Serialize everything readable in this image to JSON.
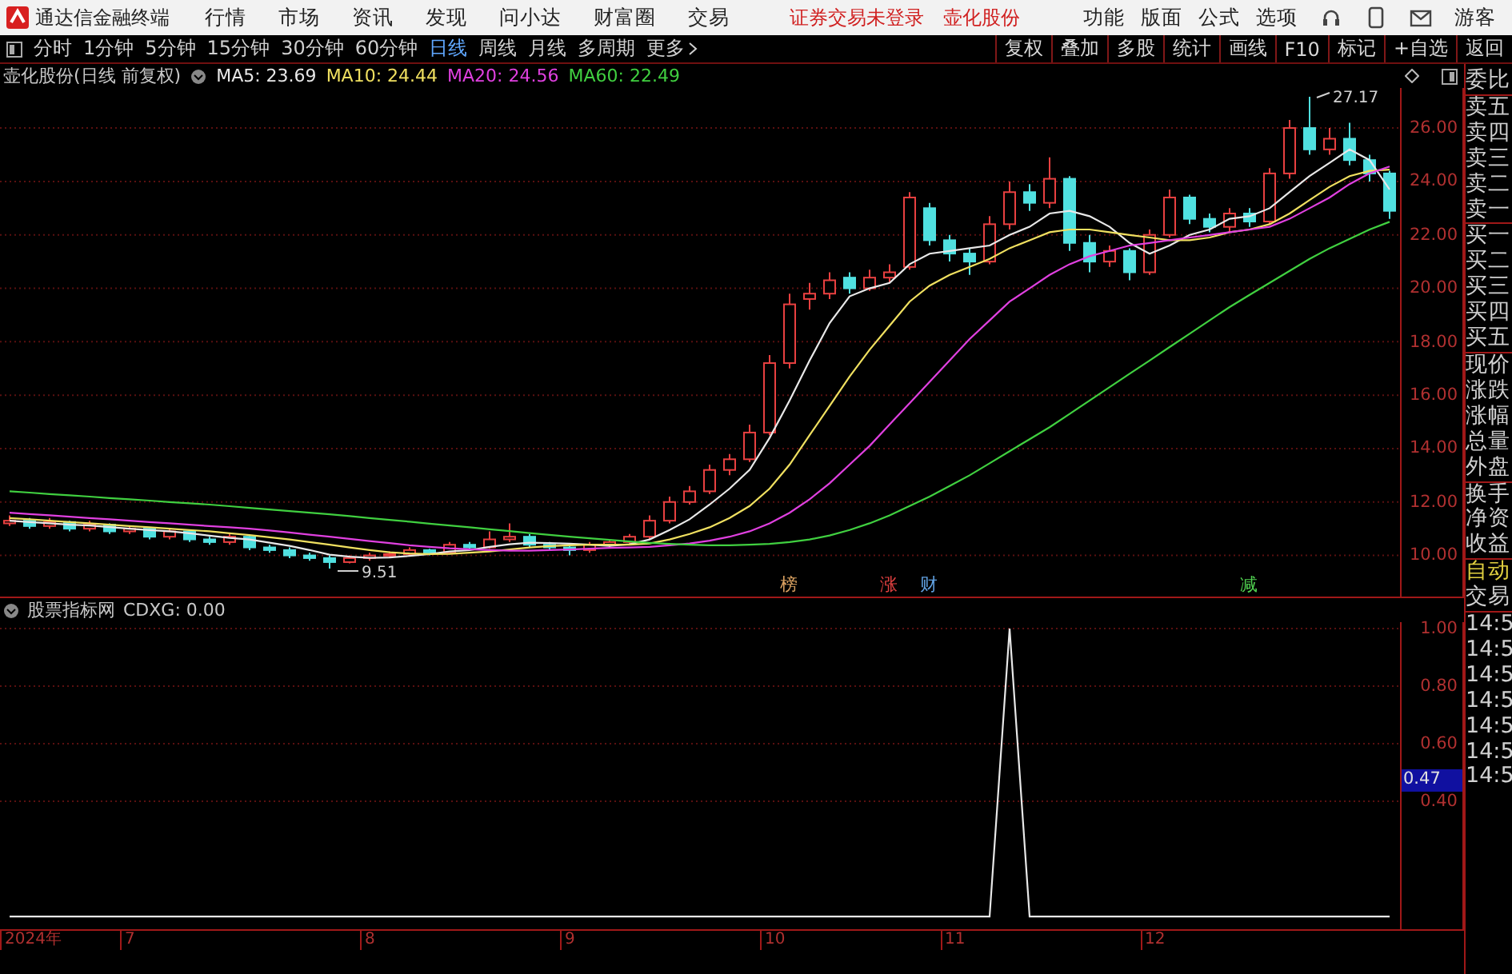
{
  "menu_bar": {
    "app_title": "通达信金融终端",
    "items": [
      "行情",
      "市场",
      "资讯",
      "发现",
      "问小达",
      "财富圈",
      "交易"
    ],
    "notices": [
      "证券交易未登录",
      "壶化股份"
    ],
    "right_items": [
      "功能",
      "版面",
      "公式",
      "选项"
    ],
    "user": "游客"
  },
  "toolbar": {
    "periods": [
      {
        "label": "分时",
        "selected": false
      },
      {
        "label": "1分钟",
        "selected": false
      },
      {
        "label": "5分钟",
        "selected": false
      },
      {
        "label": "15分钟",
        "selected": false
      },
      {
        "label": "30分钟",
        "selected": false
      },
      {
        "label": "60分钟",
        "selected": false
      },
      {
        "label": "日线",
        "selected": true
      },
      {
        "label": "周线",
        "selected": false
      },
      {
        "label": "月线",
        "selected": false
      },
      {
        "label": "多周期",
        "selected": false
      },
      {
        "label": "更多",
        "selected": false
      }
    ],
    "actions": [
      "复权",
      "叠加",
      "多股",
      "统计",
      "画线",
      "F10",
      "标记",
      "+自选",
      "返回"
    ]
  },
  "price_chart": {
    "title": "壶化股份(日线 前复权)",
    "ma": [
      {
        "label": "MA5: 23.69",
        "color": "#e8e8e8"
      },
      {
        "label": "MA10: 24.44",
        "color": "#f0e060"
      },
      {
        "label": "MA20: 24.56",
        "color": "#e040e0"
      },
      {
        "label": "MA60: 22.49",
        "color": "#40d040"
      }
    ],
    "high_label": "27.17",
    "low_label": "9.51",
    "markers": [
      {
        "text": "榜",
        "color": "#d8a060"
      },
      {
        "text": "涨",
        "color": "#e04040"
      },
      {
        "text": "财",
        "color": "#60a0e0"
      },
      {
        "text": "减",
        "color": "#50d050"
      }
    ],
    "chart_data": {
      "type": "candlestick",
      "ylim": [
        8.46,
        27.5
      ],
      "grid": true,
      "yticks": [
        {
          "value": 26,
          "label": "26.00"
        },
        {
          "value": 24,
          "label": "24.00"
        },
        {
          "value": 22,
          "label": "22.00"
        },
        {
          "value": 20,
          "label": "20.00"
        },
        {
          "value": 18,
          "label": "18.00"
        },
        {
          "value": 16,
          "label": "16.00"
        },
        {
          "value": 14,
          "label": "14.00"
        },
        {
          "value": 12,
          "label": "12.00"
        },
        {
          "value": 10,
          "label": "10.00"
        }
      ],
      "ohlc": [
        [
          11.2,
          11.5,
          11.1,
          11.3
        ],
        [
          11.3,
          11.4,
          11.0,
          11.1
        ],
        [
          11.1,
          11.4,
          11.0,
          11.25
        ],
        [
          11.25,
          11.3,
          10.9,
          11.0
        ],
        [
          11.0,
          11.3,
          10.9,
          11.15
        ],
        [
          11.15,
          11.2,
          10.8,
          10.9
        ],
        [
          10.9,
          11.1,
          10.8,
          11.0
        ],
        [
          11.0,
          11.05,
          10.6,
          10.7
        ],
        [
          10.7,
          11.0,
          10.6,
          10.9
        ],
        [
          10.9,
          10.95,
          10.5,
          10.6
        ],
        [
          10.6,
          10.7,
          10.4,
          10.5
        ],
        [
          10.5,
          10.8,
          10.4,
          10.7
        ],
        [
          10.7,
          10.75,
          10.2,
          10.3
        ],
        [
          10.3,
          10.4,
          10.1,
          10.2
        ],
        [
          10.2,
          10.3,
          9.9,
          10.0
        ],
        [
          10.0,
          10.1,
          9.8,
          9.9
        ],
        [
          9.9,
          10.0,
          9.51,
          9.75
        ],
        [
          9.75,
          10.0,
          9.7,
          9.9
        ],
        [
          9.9,
          10.1,
          9.8,
          10.0
        ],
        [
          10.0,
          10.15,
          9.9,
          10.05
        ],
        [
          10.05,
          10.3,
          10.0,
          10.2
        ],
        [
          10.2,
          10.25,
          10.0,
          10.1
        ],
        [
          10.1,
          10.5,
          10.05,
          10.4
        ],
        [
          10.4,
          10.5,
          10.2,
          10.3
        ],
        [
          10.3,
          10.9,
          10.25,
          10.6
        ],
        [
          10.6,
          11.2,
          10.5,
          10.7
        ],
        [
          10.7,
          10.8,
          10.3,
          10.4
        ],
        [
          10.4,
          10.5,
          10.2,
          10.3
        ],
        [
          10.3,
          10.4,
          10.0,
          10.2
        ],
        [
          10.2,
          10.5,
          10.1,
          10.4
        ],
        [
          10.4,
          10.6,
          10.3,
          10.5
        ],
        [
          10.5,
          10.8,
          10.4,
          10.7
        ],
        [
          10.7,
          11.5,
          10.6,
          11.3
        ],
        [
          11.3,
          12.2,
          11.2,
          12.0
        ],
        [
          12.0,
          12.6,
          11.9,
          12.4
        ],
        [
          12.4,
          13.4,
          12.3,
          13.2
        ],
        [
          13.2,
          13.8,
          13.0,
          13.6
        ],
        [
          13.6,
          14.9,
          13.5,
          14.6
        ],
        [
          14.6,
          17.5,
          14.5,
          17.2
        ],
        [
          17.2,
          19.8,
          17.0,
          19.4
        ],
        [
          19.6,
          20.2,
          19.2,
          19.8
        ],
        [
          19.8,
          20.6,
          19.6,
          20.3
        ],
        [
          20.4,
          20.6,
          19.8,
          20.0
        ],
        [
          20.0,
          20.7,
          19.9,
          20.4
        ],
        [
          20.4,
          20.9,
          20.2,
          20.6
        ],
        [
          20.8,
          23.6,
          20.7,
          23.4
        ],
        [
          23.0,
          23.2,
          21.6,
          21.8
        ],
        [
          21.8,
          22.0,
          21.0,
          21.3
        ],
        [
          21.3,
          21.5,
          20.5,
          21.0
        ],
        [
          21.0,
          22.7,
          20.9,
          22.4
        ],
        [
          22.4,
          24.0,
          22.2,
          23.6
        ],
        [
          23.6,
          23.9,
          22.9,
          23.2
        ],
        [
          23.2,
          24.9,
          23.0,
          24.1
        ],
        [
          24.1,
          24.2,
          21.4,
          21.7
        ],
        [
          21.7,
          22.0,
          20.6,
          21.0
        ],
        [
          21.0,
          21.6,
          20.8,
          21.4
        ],
        [
          21.4,
          21.5,
          20.3,
          20.6
        ],
        [
          20.6,
          22.2,
          20.5,
          22.0
        ],
        [
          22.0,
          23.7,
          21.9,
          23.4
        ],
        [
          23.4,
          23.5,
          22.4,
          22.6
        ],
        [
          22.6,
          22.8,
          22.1,
          22.3
        ],
        [
          22.3,
          23.0,
          22.1,
          22.8
        ],
        [
          22.8,
          23.0,
          22.3,
          22.5
        ],
        [
          22.5,
          24.5,
          22.4,
          24.3
        ],
        [
          24.3,
          26.3,
          24.1,
          26.0
        ],
        [
          26.0,
          27.17,
          25.0,
          25.2
        ],
        [
          25.2,
          26.0,
          25.0,
          25.6
        ],
        [
          25.6,
          26.2,
          24.6,
          24.8
        ],
        [
          24.8,
          25.0,
          24.0,
          24.3
        ],
        [
          24.3,
          24.4,
          22.6,
          22.9
        ]
      ],
      "series": [
        {
          "type": "line",
          "color": "#e8e8e8",
          "values": [
            11.3,
            11.25,
            11.2,
            11.15,
            11.12,
            11.06,
            11.0,
            10.95,
            10.9,
            10.83,
            10.74,
            10.66,
            10.6,
            10.48,
            10.36,
            10.2,
            10.03,
            9.95,
            9.91,
            9.92,
            9.98,
            10.05,
            10.15,
            10.2,
            10.32,
            10.42,
            10.48,
            10.46,
            10.44,
            10.4,
            10.36,
            10.42,
            10.6,
            10.95,
            11.35,
            11.9,
            12.5,
            13.2,
            14.4,
            15.8,
            17.3,
            18.7,
            19.7,
            20.0,
            20.2,
            20.9,
            21.3,
            21.4,
            21.5,
            21.6,
            22.0,
            22.3,
            22.8,
            22.9,
            22.7,
            22.3,
            21.7,
            21.3,
            21.6,
            22.0,
            22.2,
            22.6,
            22.7,
            23.0,
            23.6,
            24.2,
            24.7,
            25.2,
            24.8,
            23.7
          ]
        },
        {
          "type": "line",
          "color": "#f0e060",
          "values": [
            11.4,
            11.35,
            11.3,
            11.25,
            11.2,
            11.15,
            11.1,
            11.05,
            11.0,
            10.95,
            10.9,
            10.83,
            10.76,
            10.68,
            10.6,
            10.5,
            10.4,
            10.3,
            10.2,
            10.12,
            10.07,
            10.05,
            10.06,
            10.1,
            10.15,
            10.22,
            10.3,
            10.35,
            10.38,
            10.4,
            10.4,
            10.4,
            10.45,
            10.6,
            10.8,
            11.05,
            11.4,
            11.85,
            12.5,
            13.4,
            14.5,
            15.6,
            16.7,
            17.7,
            18.6,
            19.5,
            20.1,
            20.5,
            20.8,
            21.1,
            21.5,
            21.8,
            22.1,
            22.2,
            22.2,
            22.1,
            22.0,
            21.9,
            21.8,
            21.8,
            21.9,
            22.1,
            22.2,
            22.4,
            22.8,
            23.3,
            23.8,
            24.2,
            24.4,
            24.44
          ]
        },
        {
          "type": "line",
          "color": "#e040e0",
          "values": [
            11.6,
            11.55,
            11.5,
            11.45,
            11.4,
            11.35,
            11.3,
            11.25,
            11.2,
            11.15,
            11.1,
            11.05,
            11.0,
            10.93,
            10.86,
            10.78,
            10.7,
            10.62,
            10.54,
            10.46,
            10.38,
            10.32,
            10.27,
            10.23,
            10.2,
            10.18,
            10.18,
            10.2,
            10.22,
            10.25,
            10.28,
            10.3,
            10.32,
            10.38,
            10.45,
            10.55,
            10.7,
            10.9,
            11.2,
            11.6,
            12.1,
            12.7,
            13.4,
            14.1,
            14.9,
            15.7,
            16.5,
            17.3,
            18.1,
            18.8,
            19.5,
            20.0,
            20.5,
            20.9,
            21.2,
            21.4,
            21.6,
            21.7,
            21.8,
            21.9,
            22.0,
            22.1,
            22.2,
            22.3,
            22.6,
            23.0,
            23.4,
            23.9,
            24.3,
            24.56
          ]
        },
        {
          "type": "line",
          "color": "#40d040",
          "values": [
            12.4,
            12.35,
            12.3,
            12.25,
            12.2,
            12.15,
            12.1,
            12.05,
            12.0,
            11.95,
            11.9,
            11.84,
            11.78,
            11.72,
            11.66,
            11.6,
            11.54,
            11.47,
            11.4,
            11.33,
            11.26,
            11.19,
            11.12,
            11.05,
            10.98,
            10.91,
            10.84,
            10.77,
            10.7,
            10.64,
            10.58,
            10.52,
            10.47,
            10.43,
            10.4,
            10.38,
            10.38,
            10.4,
            10.43,
            10.5,
            10.6,
            10.75,
            10.95,
            11.2,
            11.5,
            11.85,
            12.2,
            12.6,
            13.0,
            13.45,
            13.9,
            14.35,
            14.8,
            15.3,
            15.8,
            16.3,
            16.8,
            17.3,
            17.8,
            18.3,
            18.8,
            19.3,
            19.75,
            20.2,
            20.65,
            21.1,
            21.5,
            21.85,
            22.2,
            22.49
          ]
        }
      ]
    }
  },
  "indicator": {
    "title": "股票指标网",
    "value": "CDXG: 0.00",
    "current": "0.47",
    "chart_data": {
      "type": "line",
      "ylim": [
        -0.044,
        1.022
      ],
      "grid": true,
      "yticks": [
        {
          "value": 1,
          "label": "1.00"
        },
        {
          "value": 0.8,
          "label": "0.80"
        },
        {
          "value": 0.6,
          "label": "0.60"
        },
        {
          "value": 0.4,
          "label": "0.40"
        }
      ],
      "series": [
        {
          "color": "#e8e8e8",
          "values": [
            0,
            0,
            0,
            0,
            0,
            0,
            0,
            0,
            0,
            0,
            0,
            0,
            0,
            0,
            0,
            0,
            0,
            0,
            0,
            0,
            0,
            0,
            0,
            0,
            0,
            0,
            0,
            0,
            0,
            0,
            0,
            0,
            0,
            0,
            0,
            0,
            0,
            0,
            0,
            0,
            0,
            0,
            0,
            0,
            0,
            0,
            0,
            0,
            0,
            0,
            1,
            0,
            0,
            0,
            0,
            0,
            0,
            0,
            0,
            0,
            0,
            0,
            0,
            0,
            0,
            0,
            0,
            0,
            0,
            0
          ]
        }
      ]
    }
  },
  "date_axis": [
    "2024年",
    "7",
    "8",
    "9",
    "10",
    "11",
    "12"
  ],
  "side_panel": {
    "quote_labels": [
      "委比",
      "卖五",
      "卖四",
      "卖三",
      "卖二",
      "卖一",
      "买一",
      "买二",
      "买三",
      "买四",
      "买五",
      "现价",
      "涨跌",
      "涨幅",
      "总量",
      "外盘",
      "换手",
      "净资",
      "收益"
    ],
    "trade_labels": [
      "自动",
      "交易"
    ],
    "times": [
      "14:5",
      "14:5",
      "14:5",
      "14:5",
      "14:5",
      "14:5",
      "14:5"
    ]
  }
}
